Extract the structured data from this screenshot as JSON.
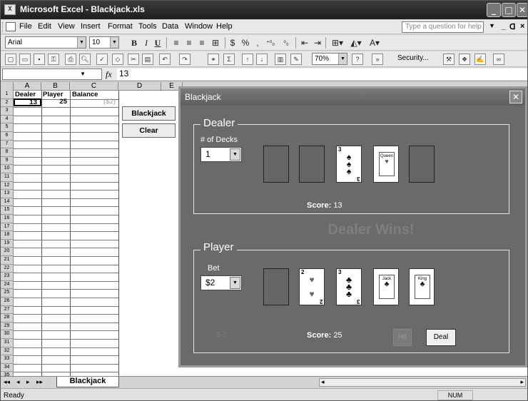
{
  "window": {
    "title": "Microsoft Excel - Blackjack.xls",
    "app_icon": "excel-icon"
  },
  "menu": [
    "File",
    "Edit",
    "View",
    "Insert",
    "Format",
    "Tools",
    "Data",
    "Window",
    "Help"
  ],
  "help_placeholder": "Type a question for help",
  "format_toolbar": {
    "font": "Arial",
    "size": "10"
  },
  "standard_toolbar": {
    "zoom": "70%",
    "security": "Security..."
  },
  "formula_bar": {
    "name_box": "",
    "fx": "fx",
    "content": "13"
  },
  "columns": [
    "A",
    "B",
    "C",
    "D",
    "E"
  ],
  "rows": [
    "1",
    "2",
    "3",
    "4",
    "5",
    "6",
    "7",
    "8",
    "9",
    "10",
    "11",
    "12",
    "13",
    "14",
    "15",
    "16",
    "17",
    "18",
    "19",
    "20",
    "21",
    "22",
    "23",
    "24",
    "25",
    "26",
    "27",
    "28",
    "29",
    "30",
    "31",
    "32",
    "33",
    "34",
    "35"
  ],
  "headers": {
    "a": "Dealer",
    "b": "Player",
    "c": "Balance"
  },
  "values": {
    "a": "13",
    "b": "25",
    "c": "($2)"
  },
  "sheet_buttons": {
    "blackjack": "Blackjack",
    "clear": "Clear"
  },
  "dialog": {
    "title": "Blackjack",
    "dealer": {
      "label": "Dealer",
      "decks_label": "# of Decks",
      "decks_value": "1",
      "cards": [
        {
          "rank": "3",
          "suit": "♠"
        },
        {
          "rank": "Queen",
          "suit": "♥"
        }
      ],
      "score_label": "Score:",
      "score": "13"
    },
    "result": "Dealer Wins!",
    "player": {
      "label": "Player",
      "bet_label": "Bet",
      "bet_value": "$2",
      "cards": [
        {
          "rank": "2",
          "suit": "♥"
        },
        {
          "rank": "3",
          "suit": "♣"
        },
        {
          "rank": "Jack",
          "suit": "♣"
        },
        {
          "rank": "King",
          "suit": "♣"
        }
      ],
      "bet_display": "$-2",
      "score_label": "Score:",
      "score": "25",
      "hit": "Hit",
      "deal": "Deal"
    }
  },
  "sheet_tab": "Blackjack",
  "status": {
    "text": "Ready",
    "num": "NUM"
  }
}
